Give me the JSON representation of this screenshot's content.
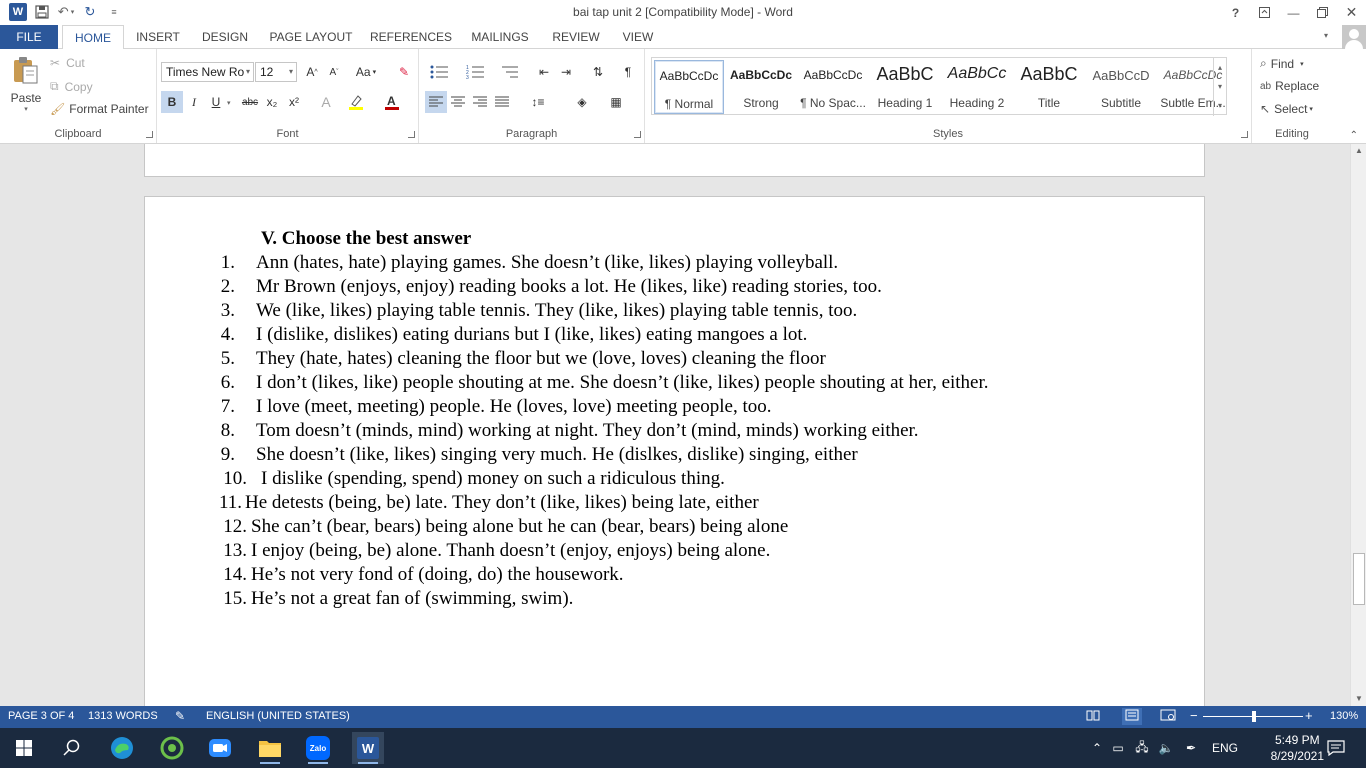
{
  "window": {
    "title": "bai tap unit 2 [Compatibility Mode] - Word",
    "help": "?"
  },
  "tabs": [
    "FILE",
    "HOME",
    "INSERT",
    "DESIGN",
    "PAGE LAYOUT",
    "REFERENCES",
    "MAILINGS",
    "REVIEW",
    "VIEW"
  ],
  "active_tab": "HOME",
  "clipboard": {
    "paste": "Paste",
    "cut": "Cut",
    "copy": "Copy",
    "format_painter": "Format Painter",
    "label": "Clipboard"
  },
  "font": {
    "name": "Times New Ro",
    "size": "12",
    "label": "Font",
    "bold": "B",
    "italic": "I",
    "underline": "U",
    "strike": "abc",
    "sub": "x₂",
    "sup": "x²",
    "change_case": "Aa"
  },
  "paragraph": {
    "label": "Paragraph"
  },
  "styles": {
    "label": "Styles",
    "items": [
      {
        "preview": "AaBbCcDc",
        "name": "¶ Normal"
      },
      {
        "preview": "AaBbCcDc",
        "name": "Strong"
      },
      {
        "preview": "AaBbCcDc",
        "name": "¶ No Spac..."
      },
      {
        "preview": "AaBbC",
        "name": "Heading 1"
      },
      {
        "preview": "AaBbCc",
        "name": "Heading 2"
      },
      {
        "preview": "AaBbC",
        "name": "Title"
      },
      {
        "preview": "AaBbCcD",
        "name": "Subtitle"
      },
      {
        "preview": "AaBbCcDc",
        "name": "Subtle Em..."
      }
    ]
  },
  "editing": {
    "label": "Editing",
    "find": "Find",
    "replace": "Replace",
    "select": "Select"
  },
  "document": {
    "heading": "V. Choose the best answer",
    "lines": [
      {
        "num": "1.",
        "text": "Ann (hates, hate) playing games. She doesn’t (like, likes) playing volleyball."
      },
      {
        "num": "2.",
        "text": "Mr Brown (enjoys, enjoy) reading books a lot. He (likes, like) reading stories, too."
      },
      {
        "num": "3.",
        "text": "We (like, likes) playing table tennis. They (like, likes) playing table tennis, too."
      },
      {
        "num": "4.",
        "text": "I (dislike, dislikes) eating durians but I (like, likes) eating mangoes a lot."
      },
      {
        "num": "5.",
        "text": "They (hate, hates) cleaning the floor but we (love, loves) cleaning the floor"
      },
      {
        "num": "6.",
        "text": "I don’t (likes, like) people shouting at me. She doesn’t (like, likes) people shouting at her, either."
      },
      {
        "num": "7.",
        "text": "I love (meet, meeting)  people. He (loves, love) meeting people, too."
      },
      {
        "num": "8.",
        "text": "Tom doesn’t (minds, mind) working at night. They don’t (mind, minds) working either."
      },
      {
        "num": "9.",
        "text": "She doesn’t (like, likes) singing very much. He (dislkes, dislike) singing, either"
      },
      {
        "num": "10.",
        "text": "I dislike (spending, spend) money on such a ridiculous thing."
      },
      {
        "num": "11.",
        "text": "He detests (being, be) late. They don’t (like, likes) being late, either"
      },
      {
        "num": "12.",
        "text": "She can’t (bear, bears) being alone but he can (bear, bears) being alone"
      },
      {
        "num": "13.",
        "text": "I enjoy (being, be) alone. Thanh doesn’t (enjoy, enjoys) being alone."
      },
      {
        "num": "14.",
        "text": "He’s not very fond of (doing, do) the housework."
      },
      {
        "num": "15.",
        "text": "He’s not a great fan of (swimming, swim)."
      }
    ]
  },
  "status": {
    "page": "PAGE 3 OF 4",
    "words": "1313 WORDS",
    "language": "ENGLISH (UNITED STATES)",
    "zoom": "130%",
    "zoom_minus": "−",
    "zoom_plus": "+"
  },
  "taskbar": {
    "lang": "ENG",
    "time": "5:49 PM",
    "date": "8/29/2021",
    "zalo": "Zalo"
  },
  "colors": {
    "word_blue": "#2b579a",
    "taskbar": "#1b2a3f",
    "highlight": "#ffff00",
    "font_color": "#c00000"
  }
}
